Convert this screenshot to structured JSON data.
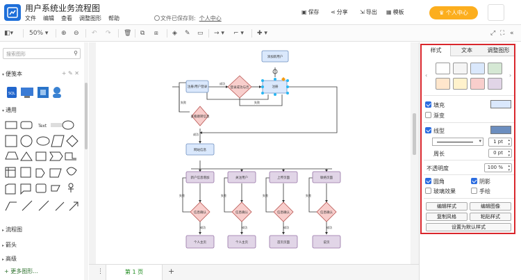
{
  "app": {
    "title": "用户系统业务流程图",
    "save_status": "文件已保存到:",
    "save_location": "个人中心"
  },
  "menu": [
    "文件",
    "编辑",
    "查看",
    "调整图形",
    "帮助"
  ],
  "top_actions": {
    "save": "保存",
    "share": "分享",
    "export": "导出",
    "template": "模板",
    "user_center": "个人中心"
  },
  "toolbar": {
    "zoom": "50%"
  },
  "left": {
    "search_placeholder": "搜索图形",
    "scratchpad": "便笺本",
    "general": "通用",
    "text_shape": "Text",
    "flowchart": "流程图",
    "arrows": "箭头",
    "advanced": "高级",
    "more_shapes": "+ 更多图形..."
  },
  "pages": {
    "tab": "第 1 页",
    "add": "+"
  },
  "panel": {
    "tabs": [
      "样式",
      "文本",
      "调整图形"
    ],
    "fill": "填充",
    "gradient": "渐变",
    "line": "线型",
    "line_width": "1 pt",
    "perimeter": "周长",
    "perimeter_value": "0 pt",
    "opacity": "不透明度",
    "opacity_value": "100 %",
    "rounded": "圆角",
    "shadow": "阴影",
    "glass": "玻璃效果",
    "sketch": "手绘",
    "buttons": [
      "编辑样式",
      "编辑图像",
      "复制风格",
      "粘贴样式"
    ],
    "default_button": "设置为默认样式",
    "swatches": [
      "#ffffff",
      "#f5f5f5",
      "#dae8fc",
      "#d5e8d4",
      "#ffe6cc",
      "#fff2cc",
      "#f8cecc",
      "#e1d5e7"
    ],
    "fill_color": "#dae8fc",
    "line_color": "#6c8ebf"
  },
  "diagram": {
    "nodes": {
      "start": "添加新用户",
      "login": "注册/用户登录",
      "check": "登录成功与否",
      "admin": "注册",
      "fail": "查看跳转信息",
      "mgmt": "网站信息",
      "b1": "新户信息增加",
      "b2": "关注用户",
      "b3": "上传页面",
      "b4": "联络页面",
      "d1": "信息确认",
      "d2": "信息确认",
      "d3": "信息确认",
      "d4": "信息确认",
      "e1": "个人主页",
      "e2": "个人主页",
      "e3": "首页页面",
      "e4": "说页"
    },
    "edges": {
      "yes": "成功",
      "no": "失败",
      "fail_no": "失败"
    }
  }
}
